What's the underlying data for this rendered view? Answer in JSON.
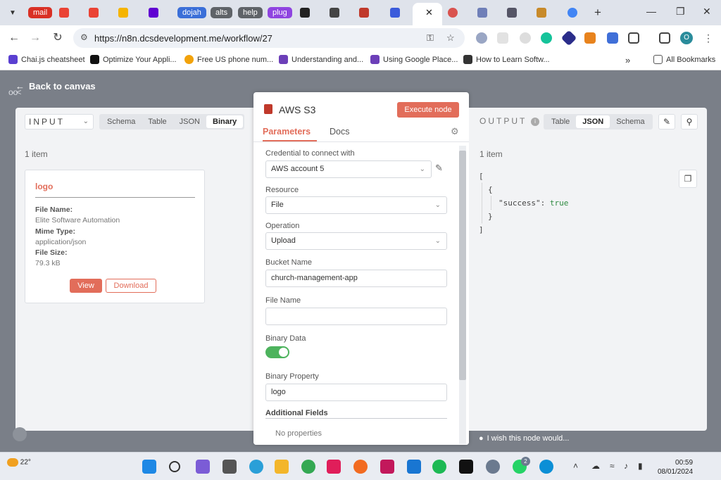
{
  "browser": {
    "tabs": [
      {
        "label": "mail",
        "color": "#d93025"
      },
      {
        "label": "dojah",
        "color": "#3b6fd8"
      },
      {
        "label": "alts",
        "color": "#5f6368"
      },
      {
        "label": "help",
        "color": "#5f6368"
      },
      {
        "label": "plug",
        "color": "#8f44e0"
      }
    ],
    "url": "https://n8n.dcsdevelopment.me/workflow/27",
    "profile_initial": "O",
    "bookmarks": [
      "Chai.js cheatsheet",
      "Optimize Your Appli...",
      "Free US phone num...",
      "Understanding and...",
      "Using Google Place...",
      "How to Learn Softw..."
    ],
    "all_bookmarks": "All Bookmarks"
  },
  "app": {
    "back_label": "Back to canvas",
    "accent": "#e26d5a"
  },
  "input_panel": {
    "select_label": "INPUT",
    "view_tabs": [
      "Schema",
      "Table",
      "JSON",
      "Binary"
    ],
    "active_tab": "Binary",
    "item_count": "1 item",
    "file": {
      "title": "logo",
      "name_label": "File Name:",
      "name_value": "Elite Software Automation",
      "mime_label": "Mime Type:",
      "mime_value": "application/json",
      "size_label": "File Size:",
      "size_value": "79.3 kB",
      "view_label": "View",
      "download_label": "Download"
    }
  },
  "node": {
    "title": "AWS S3",
    "execute_label": "Execute node",
    "tabs": [
      "Parameters",
      "Docs"
    ],
    "fields": {
      "credential_label": "Credential to connect with",
      "credential_value": "AWS account 5",
      "resource_label": "Resource",
      "resource_value": "File",
      "operation_label": "Operation",
      "operation_value": "Upload",
      "bucket_label": "Bucket Name",
      "bucket_value": "church-management-app",
      "filename_label": "File Name",
      "filename_value": "",
      "binary_label": "Binary Data",
      "binary_on": true,
      "property_label": "Binary Property",
      "property_value": "logo",
      "additional_label": "Additional Fields",
      "no_properties": "No properties"
    }
  },
  "output_panel": {
    "label": "OUTPUT",
    "view_tabs": [
      "Table",
      "JSON",
      "Schema"
    ],
    "active_tab": "JSON",
    "item_count": "1 item",
    "json": {
      "open_bracket": "[",
      "open_brace": "{",
      "key": "\"success\"",
      "colon": ":",
      "value": "true",
      "close_brace": "}",
      "close_bracket": "]"
    },
    "wish_text": "I wish this node would..."
  },
  "taskbar": {
    "temperature": "22°",
    "time": "00:59",
    "date": "08/01/2024",
    "whatsapp_badge": "2"
  }
}
